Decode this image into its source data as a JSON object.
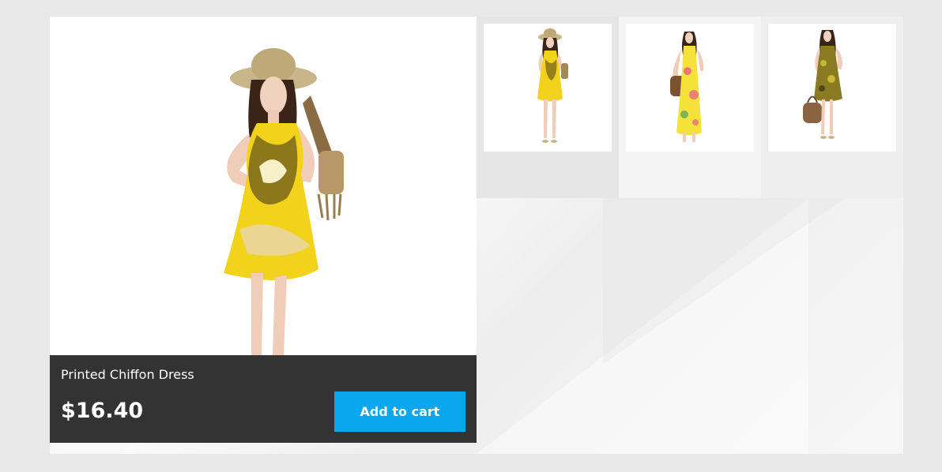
{
  "product": {
    "name": "Printed Chiffon Dress",
    "price": "$16.40",
    "add_to_cart_label": "Add to cart",
    "main_image_alt": "Printed Chiffon Dress",
    "thumbnails": [
      {
        "alt": "Yellow printed chiffon dress with hat",
        "dress_color": "#f2d21a"
      },
      {
        "alt": "Yellow floral maxi dress with bag",
        "dress_color": "#f4e23a"
      },
      {
        "alt": "Dark patterned dress with bag",
        "dress_color": "#8a7a22"
      }
    ]
  },
  "colors": {
    "accent": "#0aa6ee",
    "info_bar": "#333333",
    "page_bg": "#e9e9e9"
  }
}
